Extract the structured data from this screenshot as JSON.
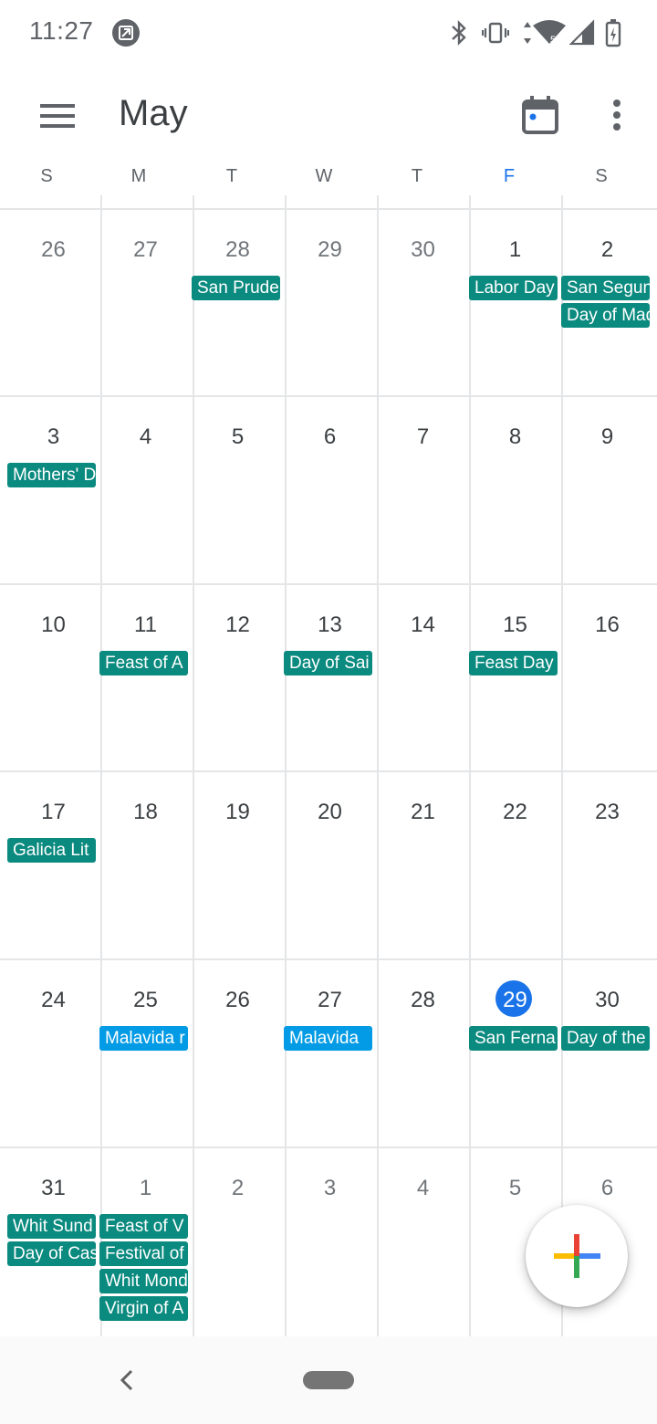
{
  "status_bar": {
    "time": "11:27"
  },
  "header": {
    "month": "May"
  },
  "weekdays": [
    {
      "label": "S",
      "today": false
    },
    {
      "label": "M",
      "today": false
    },
    {
      "label": "T",
      "today": false
    },
    {
      "label": "W",
      "today": false
    },
    {
      "label": "T",
      "today": false
    },
    {
      "label": "F",
      "today": true
    },
    {
      "label": "S",
      "today": false
    }
  ],
  "weeks": [
    [
      {
        "day": "26",
        "other": true,
        "events": []
      },
      {
        "day": "27",
        "other": true,
        "events": []
      },
      {
        "day": "28",
        "other": true,
        "events": [
          {
            "title": "San Prudencio",
            "color": "teal"
          }
        ]
      },
      {
        "day": "29",
        "other": true,
        "events": []
      },
      {
        "day": "30",
        "other": true,
        "events": []
      },
      {
        "day": "1",
        "events": [
          {
            "title": "Labor Day",
            "color": "teal"
          }
        ]
      },
      {
        "day": "2",
        "events": [
          {
            "title": "San Segundo",
            "color": "teal"
          },
          {
            "title": "Day of Madrid",
            "color": "teal"
          }
        ]
      }
    ],
    [
      {
        "day": "3",
        "events": [
          {
            "title": "Mothers' Day",
            "color": "teal"
          }
        ]
      },
      {
        "day": "4",
        "events": []
      },
      {
        "day": "5",
        "events": []
      },
      {
        "day": "6",
        "events": []
      },
      {
        "day": "7",
        "events": []
      },
      {
        "day": "8",
        "events": []
      },
      {
        "day": "9",
        "events": []
      }
    ],
    [
      {
        "day": "10",
        "events": []
      },
      {
        "day": "11",
        "events": [
          {
            "title": "Feast of A",
            "color": "teal"
          }
        ]
      },
      {
        "day": "12",
        "events": []
      },
      {
        "day": "13",
        "events": [
          {
            "title": "Day of Sai",
            "color": "teal"
          }
        ]
      },
      {
        "day": "14",
        "events": []
      },
      {
        "day": "15",
        "events": [
          {
            "title": "Feast Day",
            "color": "teal"
          }
        ]
      },
      {
        "day": "16",
        "events": []
      }
    ],
    [
      {
        "day": "17",
        "events": [
          {
            "title": "Galicia Lit",
            "color": "teal"
          }
        ]
      },
      {
        "day": "18",
        "events": []
      },
      {
        "day": "19",
        "events": []
      },
      {
        "day": "20",
        "events": []
      },
      {
        "day": "21",
        "events": []
      },
      {
        "day": "22",
        "events": []
      },
      {
        "day": "23",
        "events": []
      }
    ],
    [
      {
        "day": "24",
        "events": []
      },
      {
        "day": "25",
        "events": [
          {
            "title": "Malavida r",
            "color": "blue"
          }
        ]
      },
      {
        "day": "26",
        "events": []
      },
      {
        "day": "27",
        "events": [
          {
            "title": "Malavida",
            "color": "blue"
          }
        ]
      },
      {
        "day": "28",
        "events": []
      },
      {
        "day": "29",
        "today": true,
        "events": [
          {
            "title": "San Ferna",
            "color": "teal"
          }
        ]
      },
      {
        "day": "30",
        "events": [
          {
            "title": "Day of the",
            "color": "teal"
          }
        ]
      }
    ],
    [
      {
        "day": "31",
        "events": [
          {
            "title": "Whit Sund",
            "color": "teal"
          },
          {
            "title": "Day of Cas",
            "color": "teal"
          }
        ]
      },
      {
        "day": "1",
        "other": true,
        "events": [
          {
            "title": "Feast of V",
            "color": "teal"
          },
          {
            "title": "Festival of",
            "color": "teal"
          },
          {
            "title": "Whit Mond",
            "color": "teal"
          },
          {
            "title": "Virgin of A",
            "color": "teal"
          }
        ]
      },
      {
        "day": "2",
        "other": true,
        "events": []
      },
      {
        "day": "3",
        "other": true,
        "events": []
      },
      {
        "day": "4",
        "other": true,
        "events": []
      },
      {
        "day": "5",
        "other": true,
        "events": []
      },
      {
        "day": "6",
        "other": true,
        "events": []
      }
    ]
  ],
  "colors": {
    "teal": "#0b8a7f",
    "blue": "#039be5",
    "today": "#1a73e8"
  },
  "icons": {
    "menu": "menu-icon",
    "today": "calendar-today-icon",
    "more": "more-vert-icon",
    "fab": "add-event-icon",
    "back": "back-icon",
    "home": "home-pill-icon"
  }
}
